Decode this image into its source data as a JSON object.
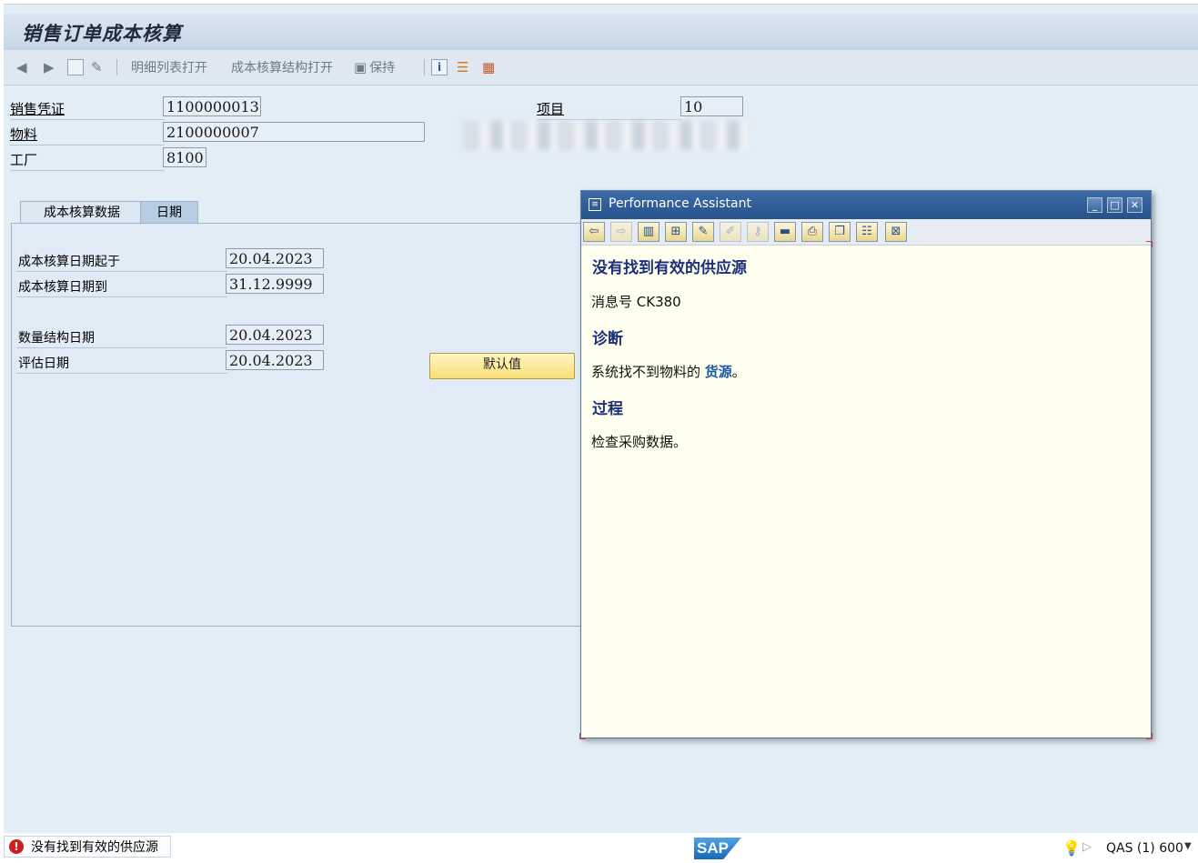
{
  "app": {
    "title": "销售订单成本核算"
  },
  "toolbar": {
    "detail_list_open": "明细列表打开",
    "costing_structure_open": "成本核算结构打开",
    "keep": "保持"
  },
  "header_fields": {
    "sales_document": {
      "label": "销售凭证",
      "value": "1100000013"
    },
    "item": {
      "label": "项目",
      "value": "10"
    },
    "material": {
      "label": "物料",
      "value": "2100000007"
    },
    "plant": {
      "label": "工厂",
      "value": "8100"
    }
  },
  "tabs": [
    {
      "label": "成本核算数据",
      "active": false
    },
    {
      "label": "日期",
      "active": true
    }
  ],
  "dates": {
    "costing_date_from": {
      "label": "成本核算日期起于",
      "value": "20.04.2023"
    },
    "costing_date_to": {
      "label": "成本核算日期到",
      "value": "31.12.9999"
    },
    "qty_structure_date": {
      "label": "数量结构日期",
      "value": "20.04.2023"
    },
    "valuation_date": {
      "label": "评估日期",
      "value": "20.04.2023"
    },
    "default_button": "默认值"
  },
  "performance_assistant": {
    "title": "Performance Assistant",
    "heading": "没有找到有效的供应源",
    "message_no": "消息号 CK380",
    "diagnosis_heading": "诊断",
    "diagnosis_prefix": "系统找不到物料的 ",
    "diagnosis_link": "货源",
    "diagnosis_suffix": "。",
    "procedure_heading": "过程",
    "procedure_text": "检查采购数据。"
  },
  "status_bar": {
    "message": "没有找到有效的供应源",
    "sap_logo": "SAP",
    "system_info": "QAS (1) 600"
  },
  "colors": {
    "background": "#e3edf6",
    "accent_button": "#f8de76",
    "popup_title": "#27528a",
    "error": "#d11c1c"
  }
}
